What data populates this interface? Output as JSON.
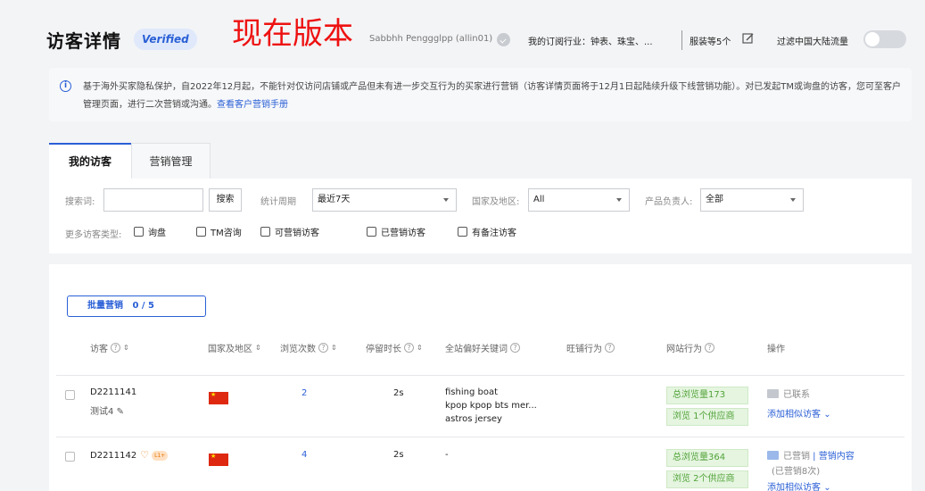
{
  "header": {
    "title": "访客详情",
    "verified_badge": "Verified",
    "version_label": "现在版本",
    "account": "Sabbhh Penggglpp (allin01)",
    "industry": "我的订阅行业：钟表、珠宝、...",
    "apparel": "服装等5个",
    "filter_label": "过滤中国大陆流量"
  },
  "notice": {
    "text": "基于海外买家隐私保护，自2022年12月起，不能针对仅访问店铺或产品但未有进一步交互行为的买家进行营销（访客详情页面将于12月1日起陆续升级下线营销功能）。对已发起TM或询盘的访客，您可至客户管理页面，进行二次营销或沟通。",
    "link": "查看客户营销手册"
  },
  "tabs": [
    {
      "label": "我的访客"
    },
    {
      "label": "营销管理"
    }
  ],
  "filters": {
    "search_label": "搜索词:",
    "search_value": "",
    "search_button": "搜索",
    "period_label": "统计周期",
    "period_value": "最近7天",
    "country_label": "国家及地区:",
    "country_value": "All",
    "owner_label": "产品负责人:",
    "owner_value": "全部",
    "more_types_label": "更多访客类型:",
    "types": [
      "询盘",
      "TM咨询",
      "可营销访客",
      "已营销访客",
      "有备注访客"
    ]
  },
  "list": {
    "batch_label": "批量营销",
    "batch_count": "0 / 5",
    "columns": [
      "访客",
      "国家及地区",
      "浏览次数",
      "停留时长",
      "全站偏好关键词",
      "旺铺行为",
      "网站行为",
      "操作"
    ],
    "rows": [
      {
        "id": "D2211141",
        "note": "测试4",
        "views": "2",
        "duration": "2s",
        "keywords": [
          "fishing boat",
          "kpop kpop bts mer...",
          "astros jersey"
        ],
        "total_views": "总浏览量173",
        "suppliers": "浏览 1个供应商",
        "status": "已联系",
        "action": "添加相似访客"
      },
      {
        "id": "D2211142",
        "badge": "L1+",
        "views": "4",
        "duration": "2s",
        "keywords": [
          "-"
        ],
        "total_views": "总浏览量364",
        "suppliers": "浏览 2个供应商",
        "status": "已营销",
        "marketing_link": "营销内容",
        "marketed_count": "(已营销8次)",
        "action": "添加相似访客"
      }
    ]
  }
}
